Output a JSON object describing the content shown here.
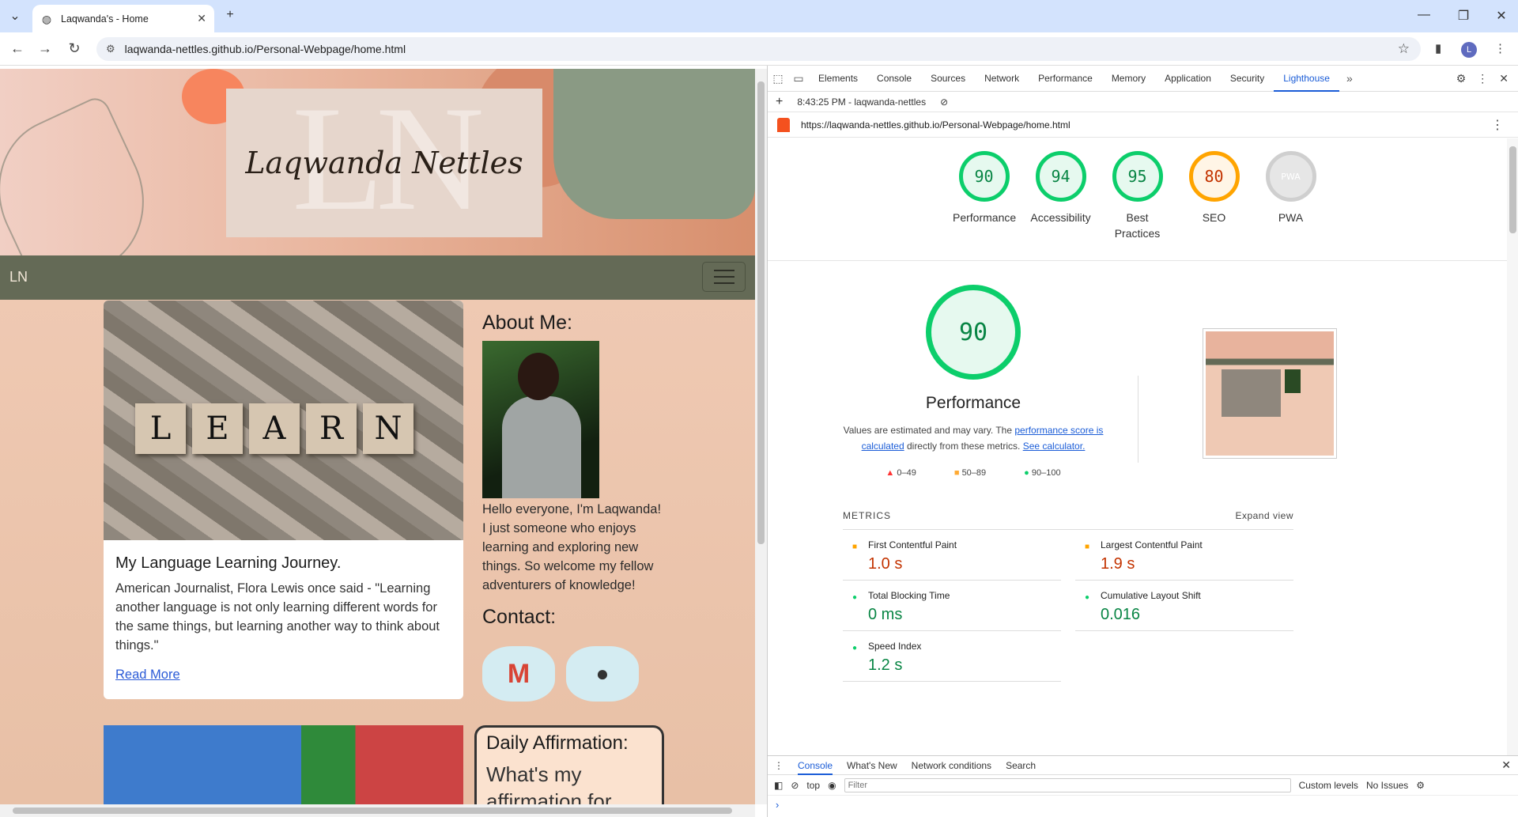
{
  "browser": {
    "tab_title": "Laqwanda's - Home",
    "url": "laqwanda-nettles.github.io/Personal-Webpage/home.html",
    "avatar_letter": "L"
  },
  "site": {
    "logo_monogram": "LN",
    "logo_name": "Laqwanda Nettles",
    "nav_brand": "LN",
    "card": {
      "title": "My Language Learning Journey.",
      "text": "American Journalist, Flora Lewis once said - \"Learning another language is not only learning different words for the same things, but learning another way to think about things.\"",
      "link": "Read More",
      "image_letters": [
        "L",
        "E",
        "A",
        "R",
        "N"
      ]
    },
    "about": {
      "heading": "About Me:",
      "text": "Hello everyone, I'm Laqwanda! I just someone who enjoys learning and exploring new things. So welcome my fellow adventurers of knowledge!"
    },
    "contact": {
      "heading": "Contact:"
    },
    "affirmation": {
      "title": "Daily Affirmation:",
      "text": "What's my affirmation for"
    }
  },
  "devtools": {
    "tabs": [
      "Elements",
      "Console",
      "Sources",
      "Network",
      "Performance",
      "Memory",
      "Application",
      "Security",
      "Lighthouse"
    ],
    "active_tab": "Lighthouse",
    "report_time": "8:43:25 PM - laqwanda-nettles",
    "report_url": "https://laqwanda-nettles.github.io/Personal-Webpage/home.html",
    "scores": [
      {
        "label": "Performance",
        "value": "90",
        "status": "good"
      },
      {
        "label": "Accessibility",
        "value": "94",
        "status": "good"
      },
      {
        "label": "Best Practices",
        "value": "95",
        "status": "good"
      },
      {
        "label": "SEO",
        "value": "80",
        "status": "average"
      },
      {
        "label": "PWA",
        "value": "PWA",
        "status": "na"
      }
    ],
    "performance": {
      "score": "90",
      "title": "Performance",
      "desc_pre": "Values are estimated and may vary. The ",
      "desc_link1": "performance score is calculated",
      "desc_mid": " directly from these metrics. ",
      "desc_link2": "See calculator."
    },
    "legend": [
      "0–49",
      "50–89",
      "90–100"
    ],
    "metrics_header": "METRICS",
    "expand_view": "Expand view",
    "metrics": [
      {
        "name": "First Contentful Paint",
        "value": "1.0 s",
        "status": "average"
      },
      {
        "name": "Largest Contentful Paint",
        "value": "1.9 s",
        "status": "average"
      },
      {
        "name": "Total Blocking Time",
        "value": "0 ms",
        "status": "good"
      },
      {
        "name": "Cumulative Layout Shift",
        "value": "0.016",
        "status": "good"
      },
      {
        "name": "Speed Index",
        "value": "1.2 s",
        "status": "good"
      }
    ],
    "drawer_tabs": [
      "Console",
      "What's New",
      "Network conditions",
      "Search"
    ],
    "console": {
      "context": "top",
      "filter_placeholder": "Filter",
      "levels": "Custom levels",
      "issues": "No Issues"
    }
  }
}
